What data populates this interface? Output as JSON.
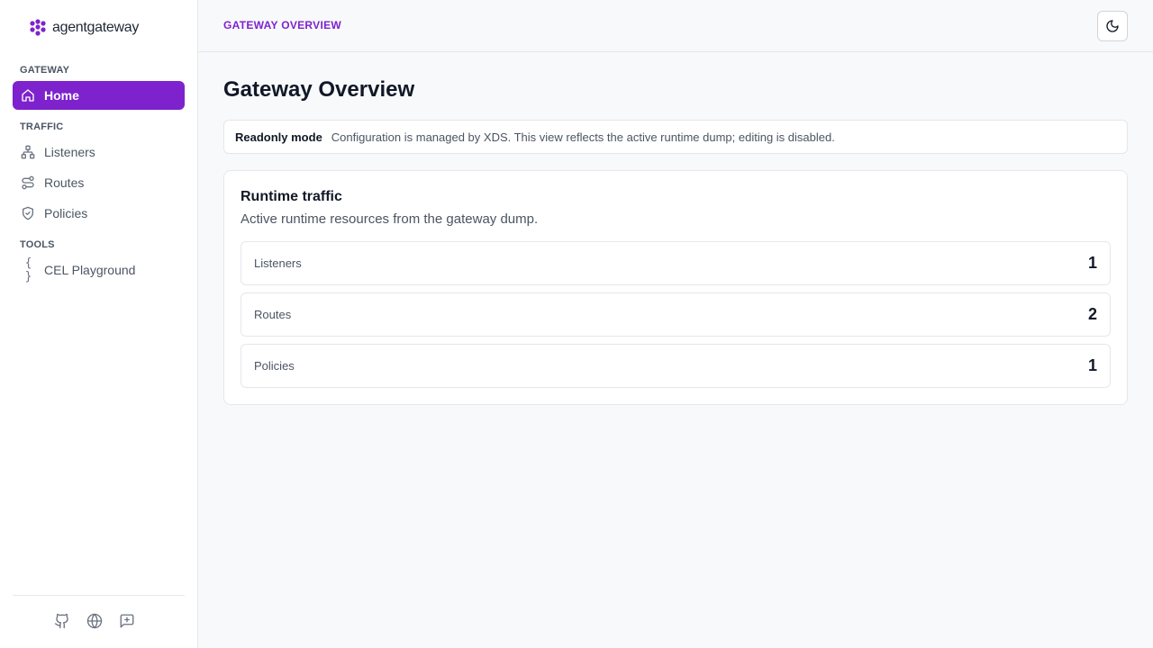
{
  "brand": {
    "name": "agentgateway",
    "logo_icon": "agentgateway-logo",
    "accent": "#7e22ce"
  },
  "sidebar": {
    "sections": [
      {
        "label": "GATEWAY"
      },
      {
        "label": "TRAFFIC"
      },
      {
        "label": "TOOLS"
      }
    ],
    "items": [
      {
        "label": "Home",
        "icon": "home-icon",
        "active": true
      },
      {
        "label": "Listeners",
        "icon": "network-icon"
      },
      {
        "label": "Routes",
        "icon": "route-icon"
      },
      {
        "label": "Policies",
        "icon": "shield-check-icon"
      },
      {
        "label": "CEL Playground",
        "icon": "braces-icon",
        "icon_text": "{ }"
      }
    ],
    "footer_icons": [
      "github-icon",
      "globe-icon",
      "message-plus-icon"
    ]
  },
  "header": {
    "title": "GATEWAY OVERVIEW",
    "theme_toggle_icon": "moon-icon"
  },
  "main": {
    "title": "Gateway Overview",
    "readonly": {
      "label": "Readonly mode",
      "message": "Configuration is managed by XDS. This view reflects the active runtime dump; editing is disabled."
    },
    "runtime_card": {
      "title": "Runtime traffic",
      "subtitle": "Active runtime resources from the gateway dump.",
      "stats": [
        {
          "label": "Listeners",
          "value": "1"
        },
        {
          "label": "Routes",
          "value": "2"
        },
        {
          "label": "Policies",
          "value": "1"
        }
      ]
    }
  }
}
